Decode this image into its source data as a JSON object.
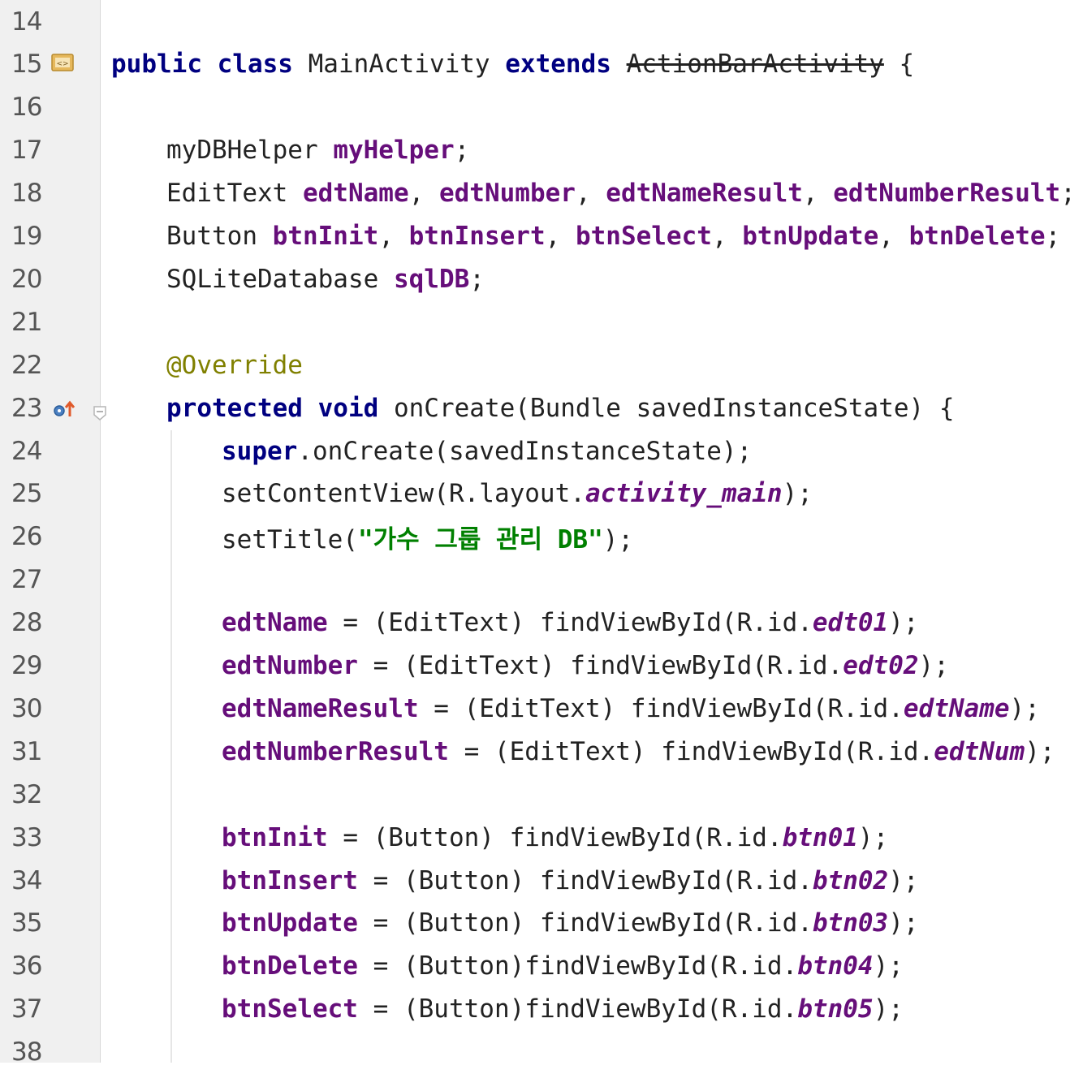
{
  "lines": [
    {
      "num": "14",
      "indent": 0,
      "tokens": []
    },
    {
      "num": "15",
      "indent": 0,
      "tokens": [
        {
          "t": "public class",
          "c": "kw"
        },
        {
          "t": " MainActivity ",
          "c": ""
        },
        {
          "t": "extends",
          "c": "kw"
        },
        {
          "t": " ",
          "c": ""
        },
        {
          "t": "ActionBarActivity",
          "c": "dep"
        },
        {
          "t": " {",
          "c": ""
        }
      ]
    },
    {
      "num": "16",
      "indent": 0,
      "tokens": []
    },
    {
      "num": "17",
      "indent": 1,
      "tokens": [
        {
          "t": "myDBHelper ",
          "c": ""
        },
        {
          "t": "myHelper",
          "c": "field"
        },
        {
          "t": ";",
          "c": ""
        }
      ]
    },
    {
      "num": "18",
      "indent": 1,
      "tokens": [
        {
          "t": "EditText ",
          "c": ""
        },
        {
          "t": "edtName",
          "c": "field"
        },
        {
          "t": ", ",
          "c": ""
        },
        {
          "t": "edtNumber",
          "c": "field"
        },
        {
          "t": ", ",
          "c": ""
        },
        {
          "t": "edtNameResult",
          "c": "field"
        },
        {
          "t": ", ",
          "c": ""
        },
        {
          "t": "edtNumberResult",
          "c": "field"
        },
        {
          "t": ";",
          "c": ""
        }
      ]
    },
    {
      "num": "19",
      "indent": 1,
      "tokens": [
        {
          "t": "Button ",
          "c": ""
        },
        {
          "t": "btnInit",
          "c": "field"
        },
        {
          "t": ", ",
          "c": ""
        },
        {
          "t": "btnInsert",
          "c": "field"
        },
        {
          "t": ", ",
          "c": ""
        },
        {
          "t": "btnSelect",
          "c": "field"
        },
        {
          "t": ", ",
          "c": ""
        },
        {
          "t": "btnUpdate",
          "c": "field"
        },
        {
          "t": ", ",
          "c": ""
        },
        {
          "t": "btnDelete",
          "c": "field"
        },
        {
          "t": ";",
          "c": ""
        }
      ]
    },
    {
      "num": "20",
      "indent": 1,
      "tokens": [
        {
          "t": "SQLiteDatabase ",
          "c": ""
        },
        {
          "t": "sqlDB",
          "c": "field"
        },
        {
          "t": ";",
          "c": ""
        }
      ]
    },
    {
      "num": "21",
      "indent": 0,
      "tokens": []
    },
    {
      "num": "22",
      "indent": 1,
      "tokens": [
        {
          "t": "@Override",
          "c": "ann"
        }
      ]
    },
    {
      "num": "23",
      "indent": 1,
      "tokens": [
        {
          "t": "protected void",
          "c": "kw"
        },
        {
          "t": " onCreate(Bundle savedInstanceState) {",
          "c": ""
        }
      ]
    },
    {
      "num": "24",
      "indent": 2,
      "tokens": [
        {
          "t": "super",
          "c": "kw"
        },
        {
          "t": ".onCreate(savedInstanceState);",
          "c": ""
        }
      ]
    },
    {
      "num": "25",
      "indent": 2,
      "tokens": [
        {
          "t": "setContentView(R.layout.",
          "c": ""
        },
        {
          "t": "activity_main",
          "c": "sfield"
        },
        {
          "t": ");",
          "c": ""
        }
      ]
    },
    {
      "num": "26",
      "indent": 2,
      "tokens": [
        {
          "t": "setTitle(",
          "c": ""
        },
        {
          "t": "\"가수 그룹 관리 DB\"",
          "c": "str"
        },
        {
          "t": ");",
          "c": ""
        }
      ]
    },
    {
      "num": "27",
      "indent": 0,
      "tokens": []
    },
    {
      "num": "28",
      "indent": 2,
      "tokens": [
        {
          "t": "edtName",
          "c": "field"
        },
        {
          "t": " = (EditText) findViewById(R.id.",
          "c": ""
        },
        {
          "t": "edt01",
          "c": "sfield"
        },
        {
          "t": ");",
          "c": ""
        }
      ]
    },
    {
      "num": "29",
      "indent": 2,
      "tokens": [
        {
          "t": "edtNumber",
          "c": "field"
        },
        {
          "t": " = (EditText) findViewById(R.id.",
          "c": ""
        },
        {
          "t": "edt02",
          "c": "sfield"
        },
        {
          "t": ");",
          "c": ""
        }
      ]
    },
    {
      "num": "30",
      "indent": 2,
      "tokens": [
        {
          "t": "edtNameResult",
          "c": "field"
        },
        {
          "t": " = (EditText) findViewById(R.id.",
          "c": ""
        },
        {
          "t": "edtName",
          "c": "sfield"
        },
        {
          "t": ");",
          "c": ""
        }
      ]
    },
    {
      "num": "31",
      "indent": 2,
      "tokens": [
        {
          "t": "edtNumberResult",
          "c": "field"
        },
        {
          "t": " = (EditText) findViewById(R.id.",
          "c": ""
        },
        {
          "t": "edtNum",
          "c": "sfield"
        },
        {
          "t": ");",
          "c": ""
        }
      ]
    },
    {
      "num": "32",
      "indent": 0,
      "tokens": []
    },
    {
      "num": "33",
      "indent": 2,
      "tokens": [
        {
          "t": "btnInit",
          "c": "field"
        },
        {
          "t": " = (Button) findViewById(R.id.",
          "c": ""
        },
        {
          "t": "btn01",
          "c": "sfield"
        },
        {
          "t": ");",
          "c": ""
        }
      ]
    },
    {
      "num": "34",
      "indent": 2,
      "tokens": [
        {
          "t": "btnInsert",
          "c": "field"
        },
        {
          "t": " = (Button) findViewById(R.id.",
          "c": ""
        },
        {
          "t": "btn02",
          "c": "sfield"
        },
        {
          "t": ");",
          "c": ""
        }
      ]
    },
    {
      "num": "35",
      "indent": 2,
      "tokens": [
        {
          "t": "btnUpdate",
          "c": "field"
        },
        {
          "t": " = (Button) findViewById(R.id.",
          "c": ""
        },
        {
          "t": "btn03",
          "c": "sfield"
        },
        {
          "t": ");",
          "c": ""
        }
      ]
    },
    {
      "num": "36",
      "indent": 2,
      "tokens": [
        {
          "t": "btnDelete",
          "c": "field"
        },
        {
          "t": " = (Button)findViewById(R.id.",
          "c": ""
        },
        {
          "t": "btn04",
          "c": "sfield"
        },
        {
          "t": ");",
          "c": ""
        }
      ]
    },
    {
      "num": "37",
      "indent": 2,
      "tokens": [
        {
          "t": "btnSelect",
          "c": "field"
        },
        {
          "t": " = (Button)findViewById(R.id.",
          "c": ""
        },
        {
          "t": "btn05",
          "c": "sfield"
        },
        {
          "t": ");",
          "c": ""
        }
      ]
    },
    {
      "num": "38",
      "indent": 0,
      "tokens": []
    }
  ],
  "gutter_icons": [
    {
      "line": "15",
      "name": "class-file-icon"
    },
    {
      "line": "23",
      "name": "override-method-icon"
    },
    {
      "line": "23",
      "name": "fold-toggle-icon"
    }
  ],
  "colors": {
    "keyword": "#000080",
    "field": "#660e7a",
    "string": "#008000",
    "annotation": "#808000",
    "gutter_bg": "#f0f0f0",
    "line_number": "#555555"
  }
}
